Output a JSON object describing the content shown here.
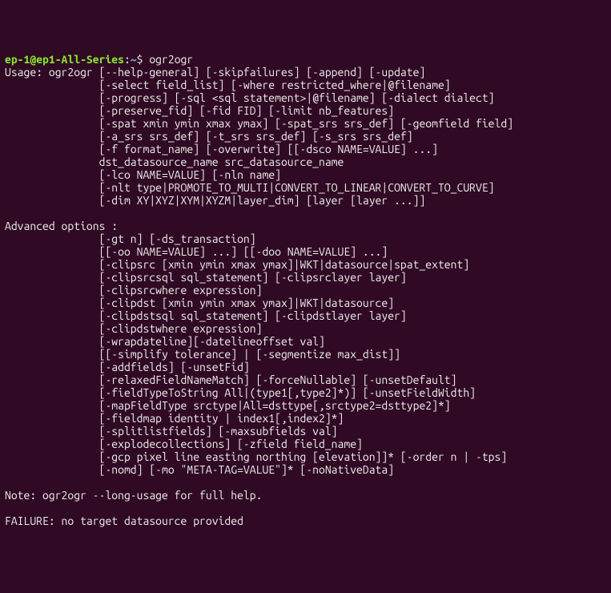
{
  "prompt": {
    "user_host": "ep-1@ep1-All-Series",
    "colon": ":",
    "path": "~",
    "dollar": "$ ",
    "command": "ogr2ogr"
  },
  "lines": [
    "Usage: ogr2ogr [--help-general] [-skipfailures] [-append] [-update]",
    "               [-select field_list] [-where restricted_where|@filename]",
    "               [-progress] [-sql <sql statement>|@filename] [-dialect dialect]",
    "               [-preserve_fid] [-fid FID] [-limit nb_features]",
    "               [-spat xmin ymin xmax ymax] [-spat_srs srs_def] [-geomfield field]",
    "               [-a_srs srs_def] [-t_srs srs_def] [-s_srs srs_def]",
    "               [-f format_name] [-overwrite] [[-dsco NAME=VALUE] ...]",
    "               dst_datasource_name src_datasource_name",
    "               [-lco NAME=VALUE] [-nln name]",
    "               [-nlt type|PROMOTE_TO_MULTI|CONVERT_TO_LINEAR|CONVERT_TO_CURVE]",
    "               [-dim XY|XYZ|XYM|XYZM|layer_dim] [layer [layer ...]]",
    "",
    "Advanced options :",
    "               [-gt n] [-ds_transaction]",
    "               [[-oo NAME=VALUE] ...] [[-doo NAME=VALUE] ...]",
    "               [-clipsrc [xmin ymin xmax ymax]|WKT|datasource|spat_extent]",
    "               [-clipsrcsql sql_statement] [-clipsrclayer layer]",
    "               [-clipsrcwhere expression]",
    "               [-clipdst [xmin ymin xmax ymax]|WKT|datasource]",
    "               [-clipdstsql sql_statement] [-clipdstlayer layer]",
    "               [-clipdstwhere expression]",
    "               [-wrapdateline][-datelineoffset val]",
    "               [[-simplify tolerance] | [-segmentize max_dist]]",
    "               [-addfields] [-unsetFid]",
    "               [-relaxedFieldNameMatch] [-forceNullable] [-unsetDefault]",
    "               [-fieldTypeToString All|(type1[,type2]*)] [-unsetFieldWidth]",
    "               [-mapFieldType srctype|All=dsttype[,srctype2=dsttype2]*]",
    "               [-fieldmap identity | index1[,index2]*]",
    "               [-splitlistfields] [-maxsubfields val]",
    "               [-explodecollections] [-zfield field_name]",
    "               [-gcp pixel line easting northing [elevation]]* [-order n | -tps]",
    "               [-nomd] [-mo \"META-TAG=VALUE\"]* [-noNativeData]",
    "",
    "Note: ogr2ogr --long-usage for full help.",
    "",
    "FAILURE: no target datasource provided"
  ]
}
